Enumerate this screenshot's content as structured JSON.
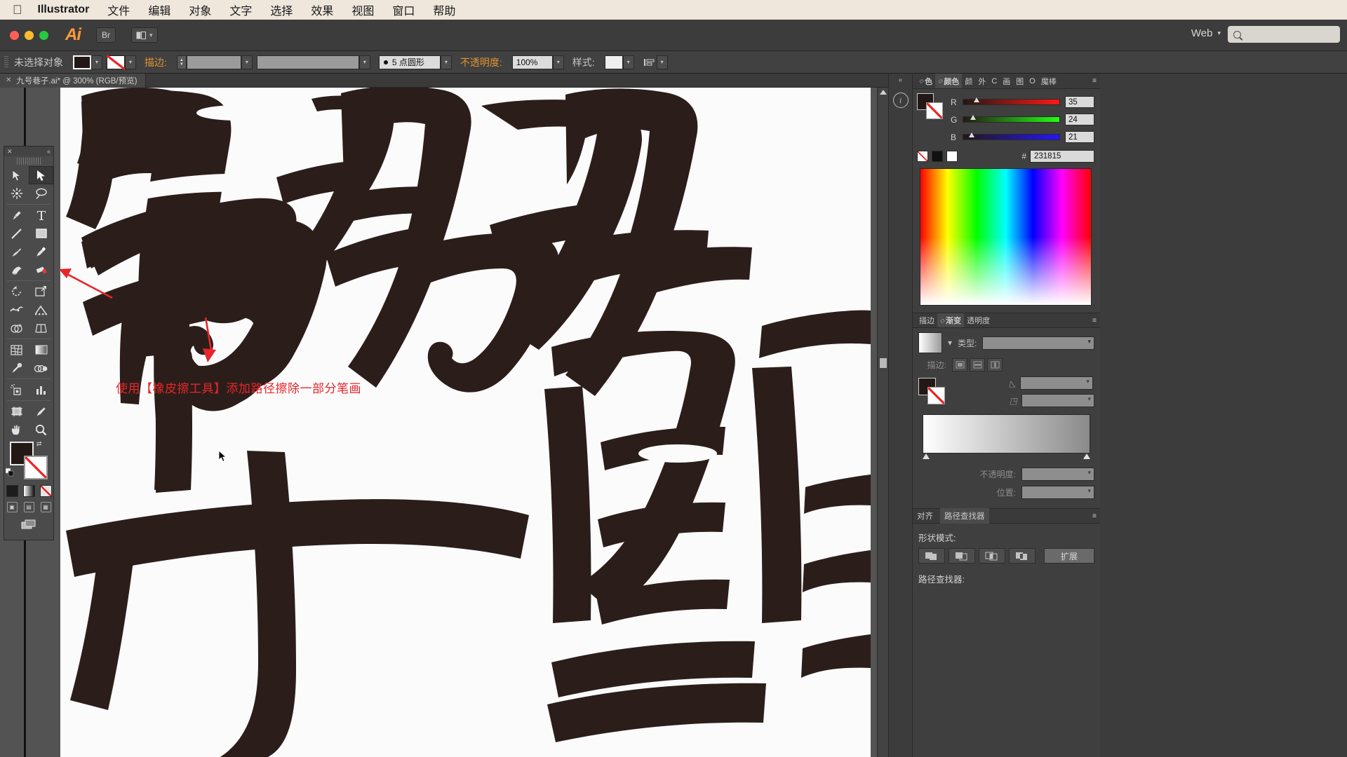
{
  "os_menu": {
    "apple_icon": "apple-icon",
    "app_name": "Illustrator",
    "items": [
      "文件",
      "编辑",
      "对象",
      "文字",
      "选择",
      "效果",
      "视图",
      "窗口",
      "帮助"
    ]
  },
  "titlebar": {
    "logo": "Ai",
    "bridge_button": "Br",
    "arrange_icon": "arrange-documents-icon",
    "workspace": "Web",
    "search_placeholder": "",
    "search_value": "",
    "search_icon": "search-icon"
  },
  "control_bar": {
    "selection_status": "未选择对象",
    "fill_swatch_color": "#231815",
    "stroke_swatch": "none",
    "stroke_label": "描边:",
    "stroke_weight_value": "",
    "stroke_profile_value": "",
    "brush_label": "5 点圆形",
    "opacity_label": "不透明度:",
    "opacity_value": "100%",
    "style_label": "样式:",
    "align_icon": "align-icon"
  },
  "document_tab": {
    "close_icon": "close-icon",
    "title": "九号巷子.ai* @ 300% (RGB/预览)"
  },
  "annotation": {
    "text": "使用【橡皮擦工具】添加路径擦除一部分笔画",
    "color": "#e8252a"
  },
  "toolbox": {
    "close_icon": "close-icon",
    "collapse_icon": "collapse-icon",
    "tools": [
      {
        "name": "selection-tool",
        "selected": false
      },
      {
        "name": "direct-selection-tool",
        "selected": true
      },
      {
        "name": "magic-wand-tool",
        "selected": false
      },
      {
        "name": "lasso-tool",
        "selected": false
      },
      {
        "name": "pen-tool",
        "selected": false
      },
      {
        "name": "type-tool",
        "selected": false
      },
      {
        "name": "line-segment-tool",
        "selected": false
      },
      {
        "name": "rectangle-tool",
        "selected": false
      },
      {
        "name": "paintbrush-tool",
        "selected": false
      },
      {
        "name": "pencil-tool",
        "selected": false
      },
      {
        "name": "blob-brush-tool",
        "selected": false
      },
      {
        "name": "eraser-tool",
        "selected": false
      },
      {
        "name": "rotate-tool",
        "selected": false
      },
      {
        "name": "scale-tool",
        "selected": false
      },
      {
        "name": "width-tool",
        "selected": false
      },
      {
        "name": "free-transform-tool",
        "selected": false
      },
      {
        "name": "shape-builder-tool",
        "selected": false
      },
      {
        "name": "perspective-grid-tool",
        "selected": false
      },
      {
        "name": "mesh-tool",
        "selected": false
      },
      {
        "name": "gradient-tool",
        "selected": false
      },
      {
        "name": "eyedropper-tool",
        "selected": false
      },
      {
        "name": "blend-tool",
        "selected": false
      },
      {
        "name": "symbol-sprayer-tool",
        "selected": false
      },
      {
        "name": "column-graph-tool",
        "selected": false
      },
      {
        "name": "artboard-tool",
        "selected": false
      },
      {
        "name": "slice-tool",
        "selected": false
      },
      {
        "name": "hand-tool",
        "selected": false
      },
      {
        "name": "zoom-tool",
        "selected": false
      }
    ],
    "fill_color": "#231815",
    "stroke_color": "none",
    "color_modes": [
      "color-swatch",
      "gradient-swatch",
      "none-swatch"
    ],
    "screen_modes": [
      "normal-screen-mode",
      "full-screen-menu-mode",
      "full-screen-mode"
    ],
    "change_screen_icon": "change-screen-mode-icon"
  },
  "dock": {
    "collapse_icon": "double-chevron-left-icon",
    "info_icon": "info-icon"
  },
  "color_panel": {
    "tabs": [
      {
        "label": "色",
        "active": false
      },
      {
        "label": "颜色",
        "active": true
      },
      {
        "label": "颜",
        "active": false
      },
      {
        "label": "外",
        "active": false
      },
      {
        "label": "C",
        "active": false
      },
      {
        "label": "画",
        "active": false
      },
      {
        "label": "图",
        "active": false
      },
      {
        "label": "O",
        "active": false
      },
      {
        "label": "魔棒",
        "active": false
      }
    ],
    "menu_icon": "panel-menu-icon",
    "channels": [
      {
        "label": "R",
        "value": "35"
      },
      {
        "label": "G",
        "value": "24"
      },
      {
        "label": "B",
        "value": "21"
      }
    ],
    "hex_symbol": "#",
    "hex_value": "231815",
    "fill_color": "#231815",
    "stroke_color": "none"
  },
  "gradient_panel": {
    "tabs": [
      {
        "label": "描边",
        "active": false
      },
      {
        "label": "渐变",
        "active": true
      },
      {
        "label": "透明度",
        "active": false
      }
    ],
    "menu_icon": "panel-menu-icon",
    "type_label": "类型:",
    "type_value": "",
    "stroke_label": "描边:",
    "stroke_buttons": [
      "gradient-within-stroke-icon",
      "gradient-along-stroke-icon",
      "gradient-across-stroke-icon"
    ],
    "angle_label": "angle-icon",
    "angle_value": "",
    "aspect_label": "aspect-ratio-icon",
    "aspect_value": "",
    "opacity_label": "不透明度:",
    "opacity_value": "",
    "location_label": "位置:",
    "location_value": "",
    "gradient_preview": "white-to-gray"
  },
  "pathfinder_panel": {
    "tabs": [
      {
        "label": "对齐",
        "active": false
      },
      {
        "label": "路径查找器",
        "active": true
      }
    ],
    "menu_icon": "panel-menu-icon",
    "shape_modes_label": "形状模式:",
    "shape_mode_buttons": [
      "unite-icon",
      "minus-front-icon",
      "intersect-icon",
      "exclude-icon"
    ],
    "expand_label": "扩展",
    "pathfinders_label": "路径查找器:"
  }
}
